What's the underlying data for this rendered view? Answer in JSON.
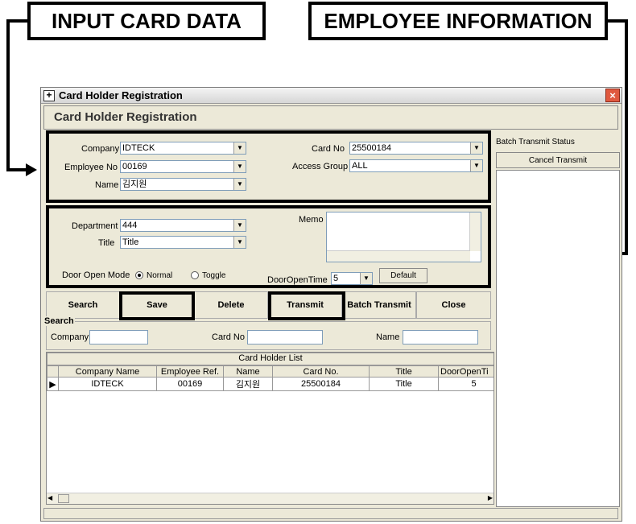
{
  "callouts": {
    "input_card_data": "INPUT CARD DATA",
    "employee_information": "EMPLOYEE INFORMATION"
  },
  "window": {
    "title": "Card Holder Registration",
    "header": "Card Holder Registration",
    "close_glyph": "×",
    "app_icon_glyph": "+"
  },
  "form": {
    "company_label": "Company",
    "company_value": "IDTECK",
    "employee_no_label": "Employee No",
    "employee_no_value": "00169",
    "name_label": "Name",
    "name_value": "김지원",
    "card_no_label": "Card No",
    "card_no_value": "25500184",
    "access_group_label": "Access Group",
    "access_group_value": "ALL",
    "department_label": "Department",
    "department_value": "444",
    "title_label": "Title",
    "title_value": "Title",
    "memo_label": "Memo",
    "door_open_mode_label": "Door Open Mode",
    "mode_normal": "Normal",
    "mode_toggle": "Toggle",
    "door_open_time_label": "DoorOpenTime",
    "door_open_time_value": "5",
    "default_button": "Default"
  },
  "side": {
    "batch_status_label": "Batch Transmit Status",
    "cancel_transmit": "Cancel Transmit"
  },
  "toolbar": {
    "search": "Search",
    "save": "Save",
    "delete": "Delete",
    "transmit": "Transmit",
    "batch_transmit": "Batch Transmit",
    "close": "Close"
  },
  "search": {
    "legend": "Search",
    "company_label": "Company",
    "card_no_label": "Card No",
    "name_label": "Name"
  },
  "list": {
    "caption": "Card Holder List",
    "columns": [
      "Company Name",
      "Employee Ref.",
      "Name",
      "Card No.",
      "Title",
      "DoorOpenTi"
    ],
    "rows": [
      [
        "IDTECK",
        "00169",
        "김지원",
        "25500184",
        "Title",
        "5"
      ]
    ]
  }
}
